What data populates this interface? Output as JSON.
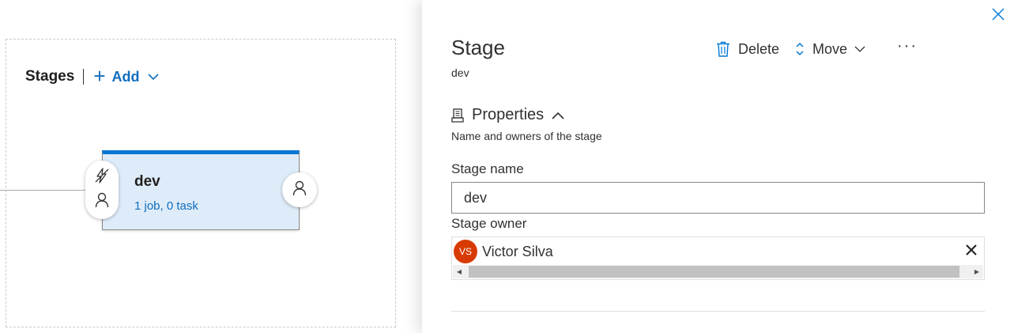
{
  "canvas": {
    "stages_title": "Stages",
    "add_label": "Add",
    "stage": {
      "name": "dev",
      "summary": "1 job, 0 task"
    }
  },
  "panel": {
    "title": "Stage",
    "subtitle": "dev",
    "toolbar": {
      "delete_label": "Delete",
      "move_label": "Move",
      "more_label": "···"
    },
    "properties": {
      "heading": "Properties",
      "description": "Name and owners of the stage"
    },
    "stage_name": {
      "label": "Stage name",
      "value": "dev"
    },
    "stage_owner": {
      "label": "Stage owner",
      "initials": "VS",
      "name": "Victor Silva",
      "avatar_color": "#d83b01"
    }
  },
  "colors": {
    "accent": "#0078d4",
    "link": "#106ebe",
    "card_bg": "#deecf9"
  },
  "icons": [
    "plus-icon",
    "chevron-down-icon",
    "pre-deployment-trigger-icon",
    "approver-icon",
    "post-deployment-approver-icon",
    "close-icon",
    "delete-icon",
    "move-icon",
    "more-icon",
    "properties-icon",
    "chevron-up-icon",
    "remove-icon"
  ]
}
